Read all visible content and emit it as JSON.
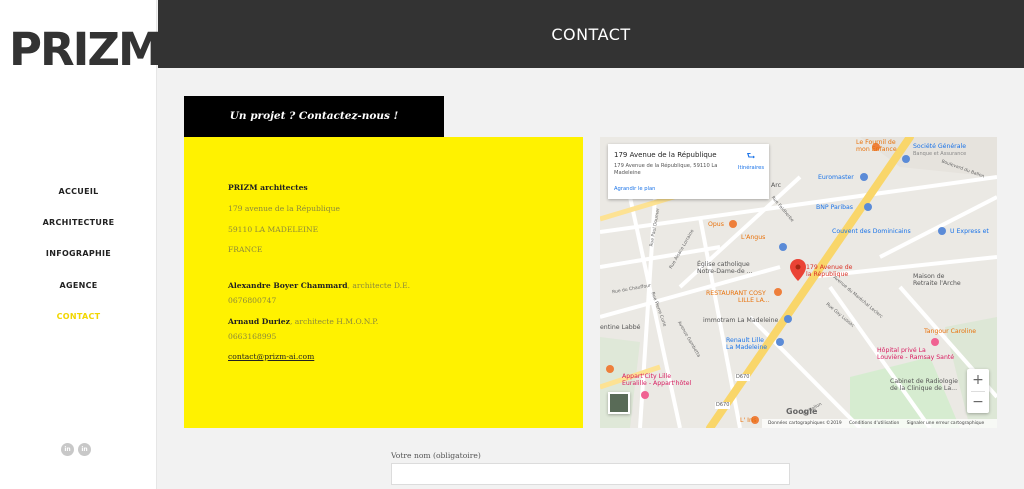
{
  "brand": {
    "logo_text": "PRIZM",
    "accent": "#ffef00"
  },
  "nav": {
    "items": [
      {
        "label": "ACCUEIL"
      },
      {
        "label": "ARCHITECTURE"
      },
      {
        "label": "INFOGRAPHIE"
      },
      {
        "label": "AGENCE"
      },
      {
        "label": "CONTACT",
        "active": true
      }
    ]
  },
  "social": {
    "items": [
      "in",
      "in"
    ]
  },
  "header": {
    "title": "CONTACT"
  },
  "tab": {
    "title": "Un projet ? Contactez-nous !"
  },
  "card": {
    "company": "PRIZM architectes",
    "street": "179 avenue de la République",
    "city": "59110 LA MADELEINE",
    "country": "FRANCE",
    "person1": {
      "name": "Alexandre Boyer Chammard",
      "title": ", architecte D.E.",
      "phone": "0676800747"
    },
    "person2": {
      "name": "Arnaud Duriez",
      "title": ", architecte H.M.O.N.P.",
      "phone": "0663168995"
    },
    "email": "contact@prizm-ai.com"
  },
  "map": {
    "place_name": "179 Avenue de la République",
    "place_address": "179 Avenue de la République, 59110 La Madeleine",
    "enlarge": "Agrandir le plan",
    "directions": "Itinéraires",
    "marker_label_1": "179 Avenue de",
    "marker_label_2": "la République",
    "zoom_in": "+",
    "zoom_out": "−",
    "google": "Google",
    "attribution": "Données cartographiques ©2019",
    "terms": "Conditions d'utilisation",
    "report": "Signaler une erreur cartographique",
    "pois": {
      "fournil1": "Le Fournil de",
      "fournil2": "mon Enfance",
      "sg1": "Société Générale",
      "sg2": "Banque et Assurance",
      "euromaster": "Euromaster",
      "bnp": "BNP Paribas",
      "opus": "Opus",
      "langus": "L'Angus",
      "couvent": "Couvent des Dominicains",
      "uexpress": "U Express et",
      "eglise1": "Église catholique",
      "eglise2": "Notre-Dame-de ...",
      "cosy1": "RESTAURANT COSY",
      "cosy2": "LILLE LA...",
      "maison1": "Maison de",
      "maison2": "Retraite l'Arche",
      "immotram": "immotram La Madeleine",
      "renault1": "Renault Lille",
      "renault2": "La Madeleine",
      "labbe": "entine Labbé",
      "tangour": "Tangour Caroline",
      "hopital1": "Hôpital privé La",
      "hopital2": "Louvière - Ramsay Santé",
      "appart1": "Appart'City Lille",
      "appart2": "Euralille - Appart'hôtel",
      "cabinet1": "Cabinet de Radiologie",
      "cabinet2": "de la Clinique de La...",
      "iris": "L' Iris",
      "arc": "Arc",
      "d670a": "D670",
      "d670b": "D670"
    },
    "roads": {
      "r1": "Rue Paul Doumer",
      "r2": "Rue du Chauffour",
      "r3": "Avenue du Maréchal Leclerc",
      "r4": "Rue Gay Lussac",
      "r5": "Avenue Gambetta",
      "r6": "Rue Pierre Curie",
      "r7": "Boulevard du Ballon",
      "r8": "Rue Alsace Lorraine",
      "r9": "Rue Faidherbe",
      "r10": "du Ballon"
    }
  },
  "form": {
    "name_label": "Votre nom (obligatoire)",
    "name_value": ""
  }
}
